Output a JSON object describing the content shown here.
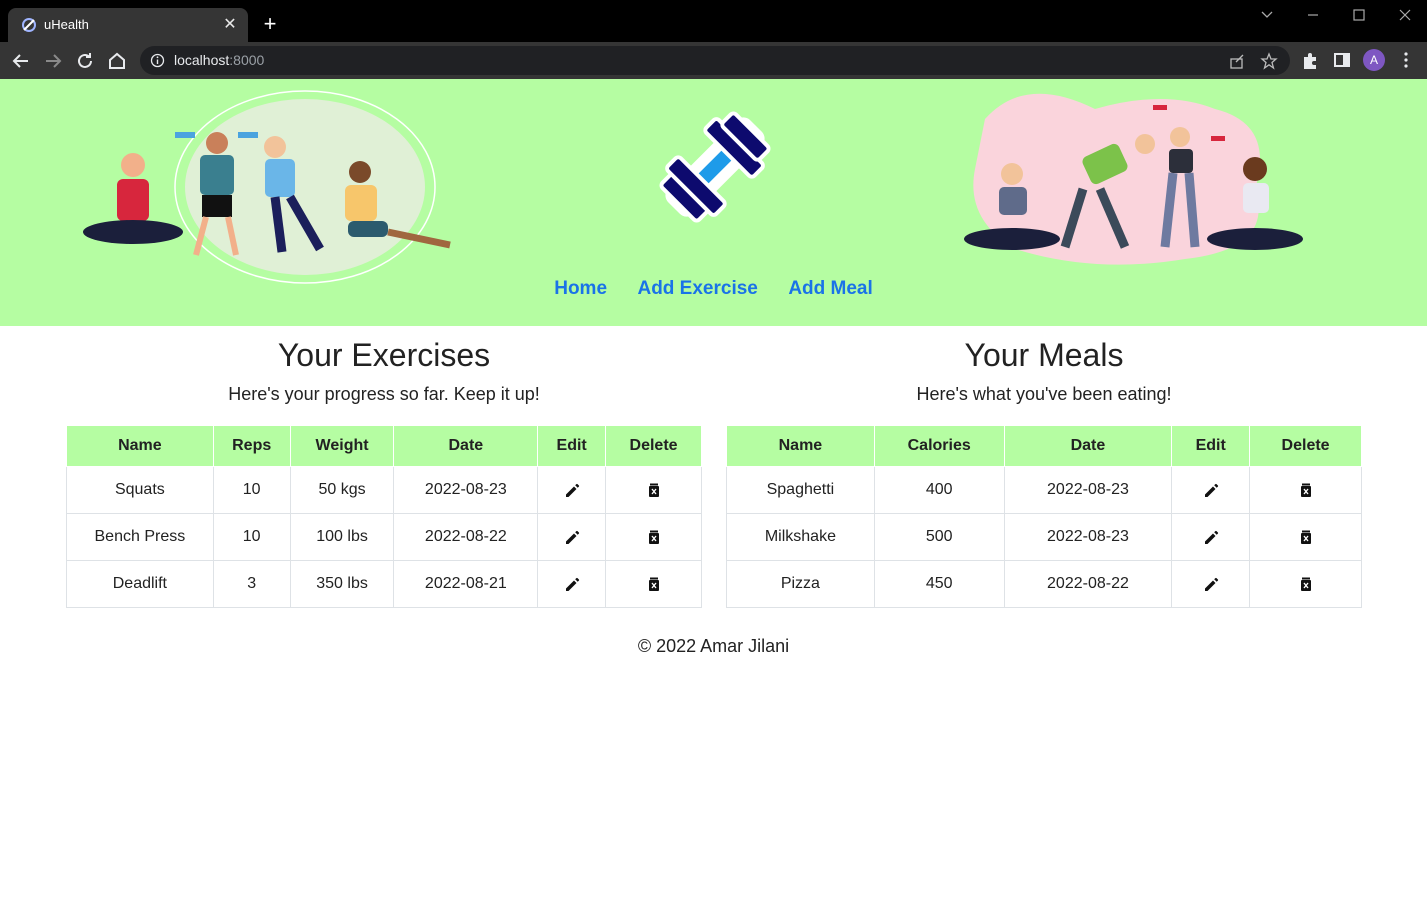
{
  "browser": {
    "tab_title": "uHealth",
    "url_host": "localhost",
    "url_port": ":8000",
    "avatar_letter": "A"
  },
  "nav": {
    "links": [
      "Home",
      "Add Exercise",
      "Add Meal"
    ]
  },
  "exercises": {
    "title": "Your Exercises",
    "subtitle": "Here's your progress so far. Keep it up!",
    "headers": [
      "Name",
      "Reps",
      "Weight",
      "Date",
      "Edit",
      "Delete"
    ],
    "rows": [
      {
        "name": "Squats",
        "reps": "10",
        "weight": "50 kgs",
        "date": "2022-08-23"
      },
      {
        "name": "Bench Press",
        "reps": "10",
        "weight": "100 lbs",
        "date": "2022-08-22"
      },
      {
        "name": "Deadlift",
        "reps": "3",
        "weight": "350 lbs",
        "date": "2022-08-21"
      }
    ]
  },
  "meals": {
    "title": "Your Meals",
    "subtitle": "Here's what you've been eating!",
    "headers": [
      "Name",
      "Calories",
      "Date",
      "Edit",
      "Delete"
    ],
    "rows": [
      {
        "name": "Spaghetti",
        "calories": "400",
        "date": "2022-08-23"
      },
      {
        "name": "Milkshake",
        "calories": "500",
        "date": "2022-08-23"
      },
      {
        "name": "Pizza",
        "calories": "450",
        "date": "2022-08-22"
      }
    ]
  },
  "footer": {
    "text": "© 2022 Amar Jilani"
  },
  "colors": {
    "hero_bg": "#b5fda2",
    "link": "#1a73e8",
    "logo_dark": "#0d0a6e",
    "logo_light": "#1e9be9"
  },
  "icons": {
    "edit": "pencil-icon",
    "delete": "trash-icon",
    "logo": "dumbbell-icon"
  }
}
